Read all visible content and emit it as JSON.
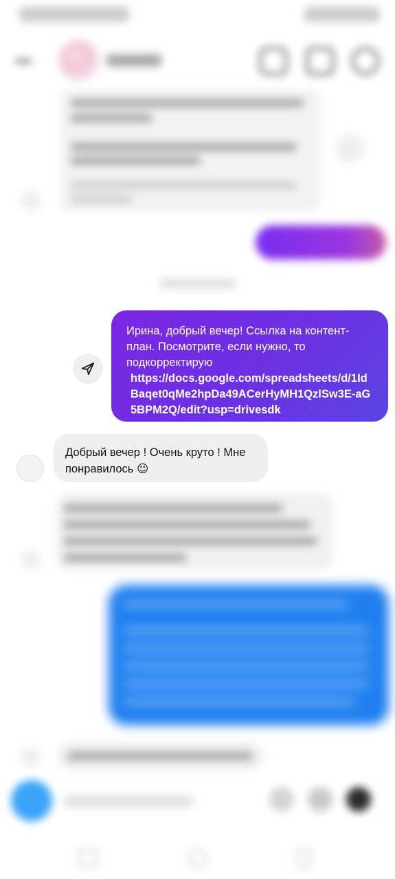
{
  "header": {
    "back_icon": "back-arrow-icon",
    "call_icon": "phone-icon",
    "video_icon": "video-icon",
    "info_icon": "info-icon"
  },
  "messages": {
    "sent_main": {
      "text": "Ирина, добрый вечер! Ссылка на контент-план. Посмотрите, если нужно, то подкорректирую",
      "link": "https://docs.google.com/spreadsheets/d/1IdBaqet0qMe2hpDa49ACerHyMH1QzlSw3E-aG5BPM2Q/edit?usp=drivesdk",
      "share_icon": "send-icon"
    },
    "received_main": {
      "text": "Добрый вечер ! Очень круто ! Мне понравилось 😉"
    }
  },
  "composer": {
    "camera_icon": "camera-icon",
    "mic_icon": "mic-icon",
    "gallery_icon": "gallery-icon",
    "sticker_icon": "sticker-icon"
  },
  "colors": {
    "sent_gradient_start": "#7b26e5",
    "sent_gradient_end": "#5b44e2",
    "received_bg": "#efefef",
    "blue_bubble": "#1f7ff0",
    "camera_button": "#3aa5f8"
  }
}
